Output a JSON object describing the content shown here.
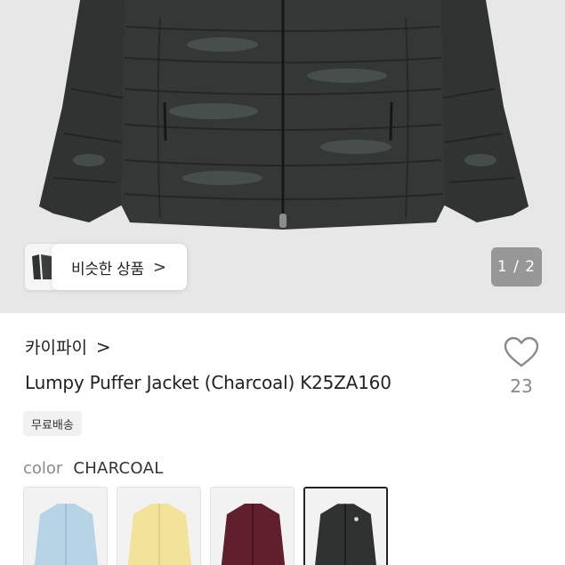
{
  "gallery": {
    "similar_label": "비슷한 상품",
    "similar_chevron": ">",
    "counter": "1 / 2"
  },
  "product": {
    "brand": "카이파이",
    "brand_chevron": ">",
    "title": "Lumpy Puffer Jacket (Charcoal) K25ZA160",
    "like_count": "23",
    "badge": "무료배송"
  },
  "color": {
    "label": "color",
    "value": "CHARCOAL",
    "options": [
      {
        "name": "light-blue",
        "hex": "#b7d3e6"
      },
      {
        "name": "yellow",
        "hex": "#f3e39a"
      },
      {
        "name": "burgundy",
        "hex": "#5f1f2b"
      },
      {
        "name": "charcoal",
        "hex": "#2e3231",
        "selected": true
      }
    ]
  },
  "colors": {
    "hero_bg": "#e7e7e8",
    "jacket": "#2e3231",
    "muted_text": "#888888"
  }
}
